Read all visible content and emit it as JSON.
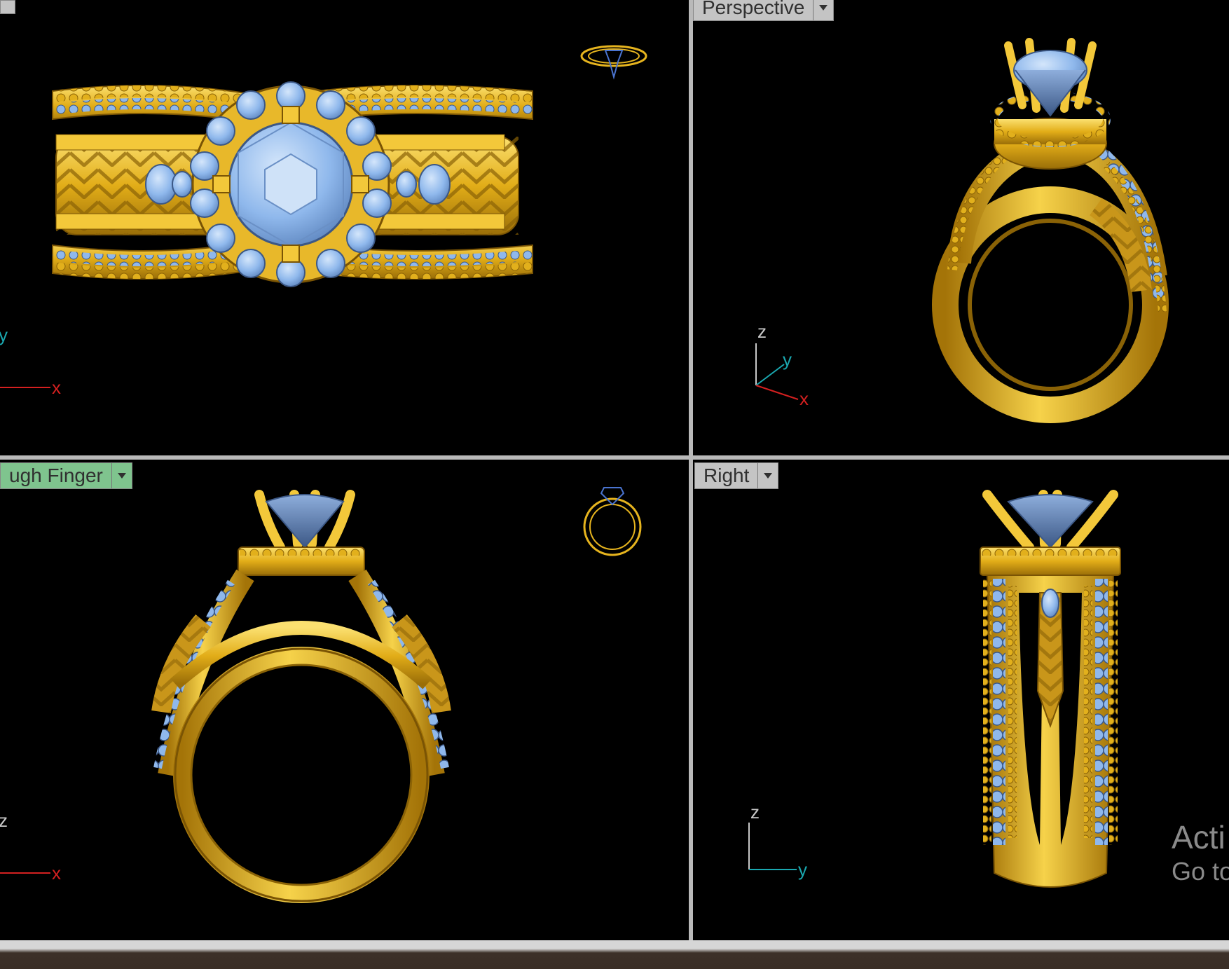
{
  "viewports": {
    "top": {
      "axis_y": "y",
      "axis_x": "x"
    },
    "perspective": {
      "label": "Perspective",
      "axis_z": "z",
      "axis_y": "y",
      "axis_x": "x"
    },
    "front": {
      "label": "ugh Finger",
      "axis_z": "z",
      "axis_x": "x"
    },
    "right": {
      "label": "Right",
      "axis_z": "z",
      "axis_y": "y"
    }
  },
  "watermark": {
    "line1": "Acti",
    "line2": "Go to"
  },
  "icons": [
    "dropdown-arrow-icon",
    "axis-gizmo-icon",
    "mini-preview-icon"
  ],
  "colors": {
    "viewport_bg": "#000000",
    "gold": "#e6b41e",
    "gem": "#8fb8ec",
    "axis_x": "#d42020",
    "axis_y": "#1aa8b0",
    "axis_z": "#c8c8c8",
    "tab_active": "#7fc48e"
  }
}
